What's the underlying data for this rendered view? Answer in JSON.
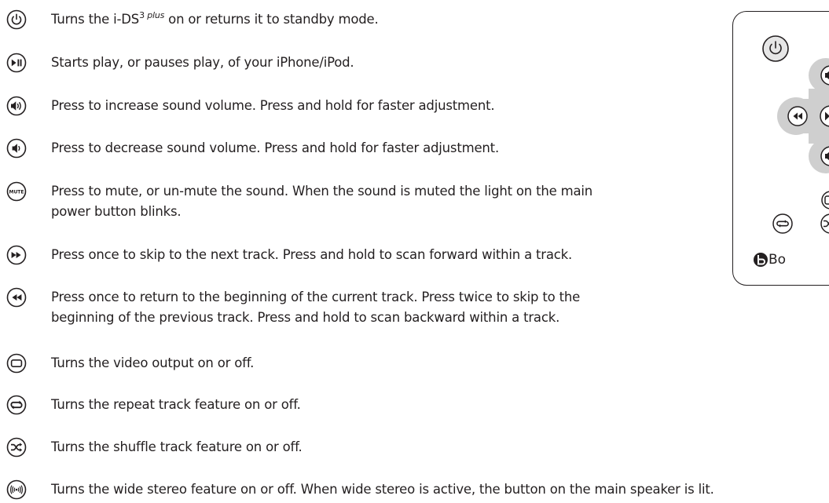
{
  "items": [
    {
      "icon": "power-icon",
      "pre": "Turns the i-DS",
      "sup": "3",
      "sup_plus": "plus",
      "post": " on or returns it to standby mode."
    },
    {
      "icon": "play-pause-icon",
      "text": "Starts play, or pauses play, of your iPhone/iPod."
    },
    {
      "icon": "volume-up-icon",
      "text": "Press to increase sound volume. Press and hold for faster adjustment."
    },
    {
      "icon": "volume-down-icon",
      "text": "Press to decrease sound volume. Press and hold for faster adjustment."
    },
    {
      "icon": "mute-icon",
      "icon_label": "MUTE",
      "line1": "Press to mute, or un-mute the sound. When the sound is muted the light on the main",
      "line2": "power button blinks."
    },
    {
      "icon": "next-track-icon",
      "text": "Press once to skip to the next track. Press and hold to scan forward within a track."
    },
    {
      "icon": "previous-track-icon",
      "line1": "Press once to return to the beginning of the current track. Press twice to skip to the",
      "line2": "beginning of the previous  track. Press and hold to scan backward within a track."
    },
    {
      "icon": "video-output-icon",
      "text": "Turns the video output on or off."
    },
    {
      "icon": "repeat-icon",
      "text": "Turns the repeat track feature on or off."
    },
    {
      "icon": "shuffle-icon",
      "text": "Turns the shuffle track feature on or off."
    },
    {
      "icon": "wide-stereo-icon",
      "text": "Turns the wide stereo feature on or off. When wide stereo is active, the button on the main speaker is lit."
    }
  ],
  "remote": {
    "brand": "Bo"
  }
}
